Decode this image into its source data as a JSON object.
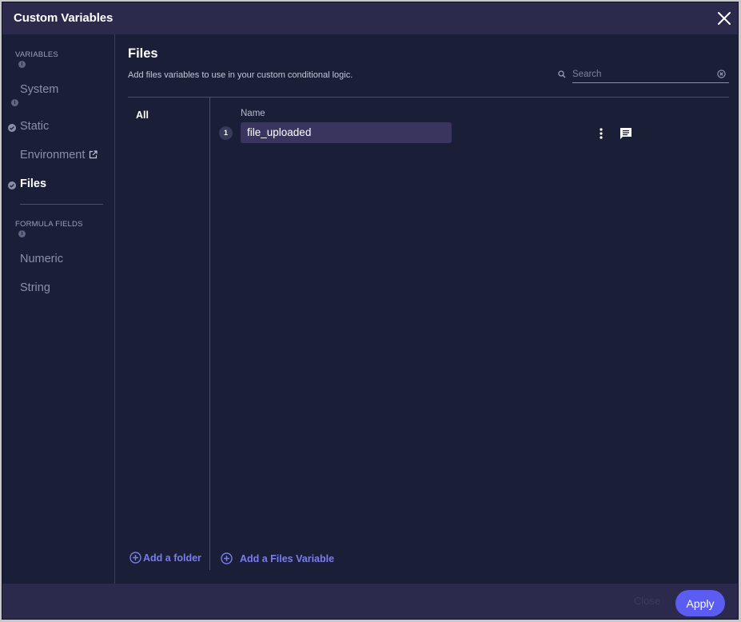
{
  "dialog": {
    "title": "Custom Variables"
  },
  "sidebar": {
    "variables_label": "VARIABLES",
    "items": [
      {
        "label": "System",
        "checked": false,
        "active": false
      },
      {
        "label": "Static",
        "checked": true,
        "active": false
      },
      {
        "label": "Environment",
        "checked": false,
        "active": false,
        "external_link": true
      },
      {
        "label": "Files",
        "checked": true,
        "active": true
      }
    ],
    "formula_label": "FORMULA FIELDS",
    "formula_items": [
      {
        "label": "Numeric"
      },
      {
        "label": "String"
      }
    ],
    "info_glyph": "i"
  },
  "main": {
    "title": "Files",
    "description": "Add files variables to use in your custom conditional logic.",
    "search_placeholder": "Search",
    "folders": [
      {
        "label": "All"
      }
    ],
    "column_name": "Name",
    "rows": [
      {
        "index": "1",
        "name": "file_uploaded"
      }
    ],
    "add_folder_label": "Add a folder",
    "add_variable_label": "Add a Files Variable"
  },
  "footer": {
    "cancel_label": "Close",
    "apply_label": "Apply"
  },
  "colors": {
    "background": "#1a1f37",
    "header": "#2b2a4c",
    "accent": "#5b5cf2",
    "link": "#7a7cf0",
    "field": "#3a355e"
  }
}
